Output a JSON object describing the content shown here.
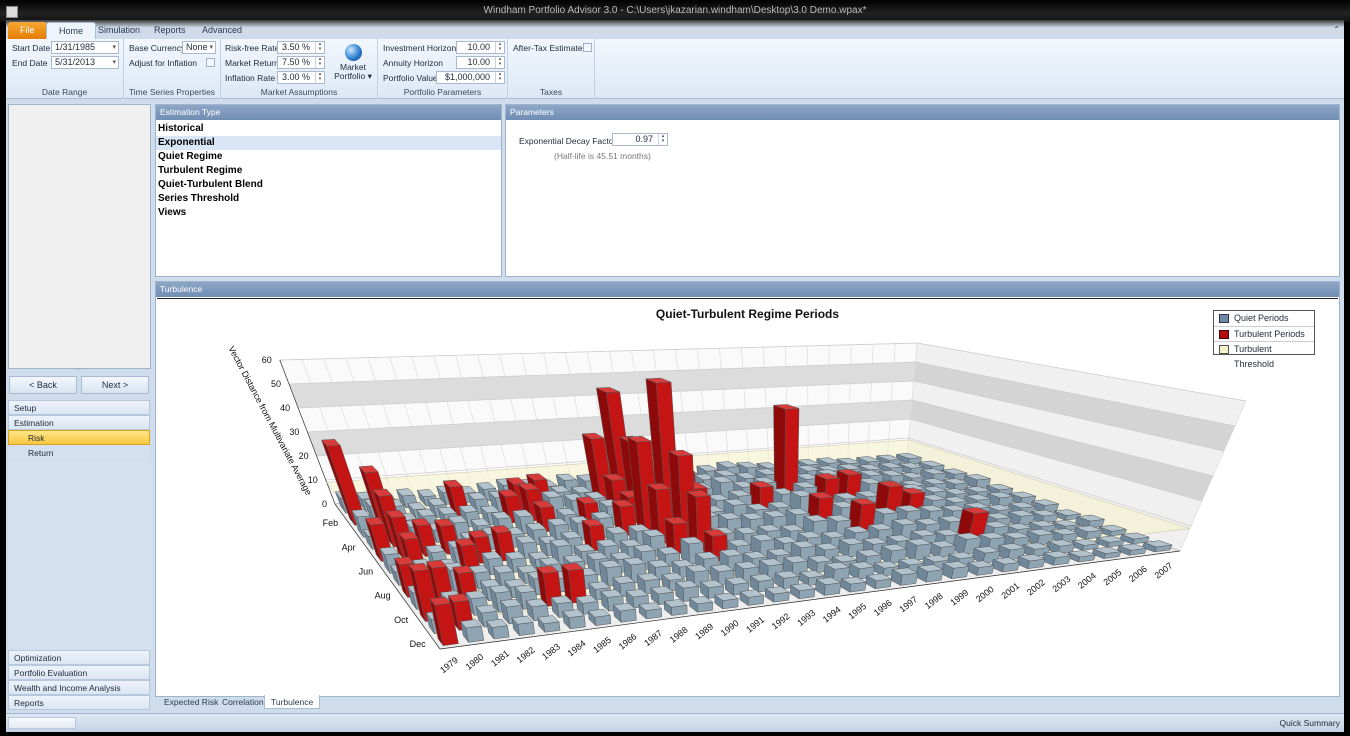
{
  "window": {
    "title": "Windham Portfolio Advisor 3.0 - C:\\Users\\jkazarian.windham\\Desktop\\3.0 Demo.wpax*"
  },
  "ribbon_tabs": [
    "File",
    "Home",
    "Simulation",
    "Reports",
    "Advanced"
  ],
  "ribbon": {
    "date_range": {
      "label": "Date Range",
      "start_label": "Start Date",
      "start": "1/31/1985",
      "end_label": "End Date",
      "end": "5/31/2013"
    },
    "time_series": {
      "label": "Time Series Properties",
      "currency_label": "Base Currency",
      "currency": "None",
      "inflation_label": "Adjust for Inflation"
    },
    "market": {
      "label": "Market Assumptions",
      "rf_label": "Risk-free Rate",
      "rf": "3.50 %",
      "mr_label": "Market Return",
      "mr": "7.50 %",
      "inf_label": "Inflation Rate",
      "inf": "3.00 %",
      "portfolio_btn_1": "Market",
      "portfolio_btn_2": "Portfolio ▾"
    },
    "portfolio": {
      "label": "Portfolio Parameters",
      "ih_label": "Investment Horizon",
      "ih": "10.00",
      "ah_label": "Annuity Horizon",
      "ah": "10.00",
      "pv_label": "Portfolio Value",
      "pv": "$1,000,000"
    },
    "taxes": {
      "label": "Taxes",
      "ate_label": "After-Tax Estimates"
    }
  },
  "nav": {
    "back": "<   Back",
    "next": "Next   >",
    "items": [
      "Setup",
      "Estimation",
      "Risk",
      "Return"
    ],
    "bottom_items": [
      "Optimization",
      "Portfolio Evaluation",
      "Wealth and Income Analysis",
      "Reports"
    ]
  },
  "estimation": {
    "header": "Estimation Type",
    "items": [
      "Historical",
      "Exponential",
      "Quiet Regime",
      "Turbulent Regime",
      "Quiet-Turbulent Blend",
      "Series Threshold",
      "Views"
    ],
    "selected": 1
  },
  "parameters": {
    "header": "Parameters",
    "decay_label": "Exponential Decay Factor:",
    "decay": "0.97",
    "half_life": "(Half-life is 45.51 months)"
  },
  "turbulence": {
    "header": "Turbulence"
  },
  "bottom_tabs": [
    "Expected Risk",
    "Correlation",
    "Turbulence"
  ],
  "status": {
    "quick_summary": "Quick Summary"
  },
  "colors": {
    "quiet": "#7f97a8",
    "turbulent": "#b00d0d",
    "threshold": "#f6f2c8",
    "accent": "#f7c640"
  },
  "chart_data": {
    "type": "bar3d",
    "title": "Quiet-Turbulent Regime Periods",
    "ylabel": "Vector Distance from Multivariate Average",
    "ylim": [
      0,
      60
    ],
    "yticks": [
      0,
      10,
      20,
      30,
      40,
      50,
      60
    ],
    "legend": [
      "Quiet Periods",
      "Turbulent Periods",
      "Turbulent Threshold"
    ],
    "legend_position": "top-right",
    "threshold": 9,
    "month_labels": [
      "Feb",
      "Apr",
      "Jun",
      "Aug",
      "Oct",
      "Dec"
    ],
    "years": [
      "1979",
      "1980",
      "1981",
      "1982",
      "1983",
      "1984",
      "1985",
      "1986",
      "1987",
      "1988",
      "1989",
      "1990",
      "1991",
      "1992",
      "1993",
      "1994",
      "1995",
      "1996",
      "1997",
      "1998",
      "1999",
      "2000",
      "2001",
      "2002",
      "2003",
      "2004",
      "2005",
      "2006",
      "2007"
    ],
    "values": [
      [
        6,
        32,
        8,
        5,
        14,
        7,
        5,
        12,
        6,
        18,
        5,
        14
      ],
      [
        5,
        7,
        25,
        20,
        16,
        12,
        6,
        5,
        14,
        7,
        10,
        5
      ],
      [
        4,
        6,
        5,
        7,
        12,
        6,
        5,
        8,
        11,
        6,
        5,
        4
      ],
      [
        5,
        4,
        6,
        5,
        11,
        7,
        12,
        6,
        5,
        7,
        6,
        4
      ],
      [
        4,
        5,
        6,
        7,
        5,
        10,
        6,
        5,
        4,
        6,
        5,
        3
      ],
      [
        5,
        12,
        6,
        5,
        6,
        11,
        5,
        4,
        6,
        12,
        5,
        4
      ],
      [
        4,
        6,
        5,
        7,
        5,
        6,
        4,
        6,
        5,
        12,
        4,
        3
      ],
      [
        5,
        6,
        11,
        7,
        6,
        5,
        8,
        6,
        5,
        4,
        5,
        4
      ],
      [
        6,
        11,
        13,
        10,
        7,
        6,
        5,
        6,
        7,
        5,
        4,
        3
      ],
      [
        5,
        12,
        9,
        6,
        7,
        10,
        6,
        5,
        7,
        5,
        4,
        3
      ],
      [
        4,
        6,
        7,
        10,
        8,
        6,
        5,
        7,
        5,
        4,
        5,
        3
      ],
      [
        6,
        5,
        7,
        8,
        12,
        6,
        8,
        5,
        4,
        6,
        4,
        3
      ],
      [
        5,
        28,
        14,
        11,
        38,
        22,
        12,
        8,
        6,
        5,
        4,
        3
      ],
      [
        7,
        48,
        30,
        20,
        62,
        35,
        22,
        10,
        6,
        5,
        4,
        3
      ],
      [
        5,
        7,
        8,
        6,
        12,
        9,
        6,
        5,
        4,
        5,
        4,
        3
      ],
      [
        4,
        6,
        7,
        12,
        6,
        7,
        5,
        6,
        4,
        5,
        3,
        4
      ],
      [
        5,
        10,
        7,
        6,
        8,
        6,
        5,
        4,
        6,
        4,
        5,
        3
      ],
      [
        4,
        6,
        9,
        7,
        5,
        6,
        4,
        5,
        4,
        3,
        4,
        3
      ],
      [
        5,
        7,
        6,
        10,
        5,
        6,
        7,
        4,
        5,
        4,
        3,
        4
      ],
      [
        6,
        5,
        7,
        6,
        9,
        12,
        6,
        5,
        4,
        5,
        3,
        4
      ],
      [
        5,
        6,
        40,
        8,
        6,
        7,
        12,
        5,
        4,
        6,
        3,
        4
      ],
      [
        4,
        6,
        7,
        11,
        6,
        5,
        7,
        6,
        5,
        4,
        3,
        3
      ],
      [
        5,
        6,
        8,
        12,
        6,
        14,
        7,
        5,
        4,
        6,
        4,
        3
      ],
      [
        4,
        5,
        6,
        7,
        5,
        10,
        6,
        5,
        12,
        5,
        4,
        3
      ],
      [
        4,
        5,
        6,
        5,
        7,
        6,
        5,
        4,
        5,
        4,
        3,
        3
      ],
      [
        3,
        4,
        5,
        4,
        5,
        4,
        5,
        4,
        3,
        4,
        3,
        2
      ],
      [
        3,
        4,
        3,
        4,
        3,
        4,
        3,
        4,
        3,
        3,
        2,
        2
      ],
      [
        3,
        3,
        4,
        3,
        3,
        4,
        3,
        3,
        2,
        3,
        2,
        2
      ],
      [
        3,
        3,
        3,
        4,
        3,
        3,
        3,
        2,
        3,
        2,
        2,
        2
      ]
    ]
  }
}
